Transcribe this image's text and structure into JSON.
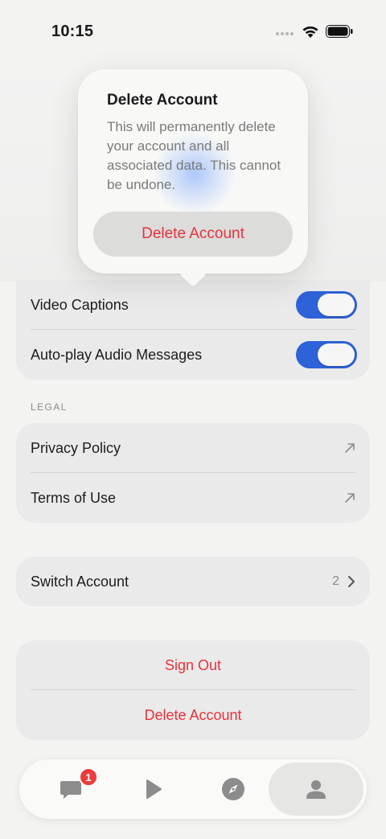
{
  "status_bar": {
    "time": "10:15"
  },
  "popover": {
    "title": "Delete Account",
    "message": "This will permanently delete your account and all associated data. This cannot be undone.",
    "confirm_label": "Delete Account"
  },
  "media_settings": {
    "items": [
      {
        "label": "Video Captions",
        "enabled": true
      },
      {
        "label": "Auto-play Audio Messages",
        "enabled": true
      }
    ]
  },
  "legal": {
    "header": "LEGAL",
    "items": [
      {
        "label": "Privacy Policy"
      },
      {
        "label": "Terms of Use"
      }
    ]
  },
  "account": {
    "switch_label": "Switch Account",
    "account_count": "2"
  },
  "actions": {
    "sign_out_label": "Sign Out",
    "delete_label": "Delete Account"
  },
  "tab_bar": {
    "chats_badge": "1",
    "active_tab": "profile"
  },
  "colors": {
    "accent": "#2d62d8",
    "destructive": "#e8323a",
    "badge": "#ee3b3b"
  }
}
